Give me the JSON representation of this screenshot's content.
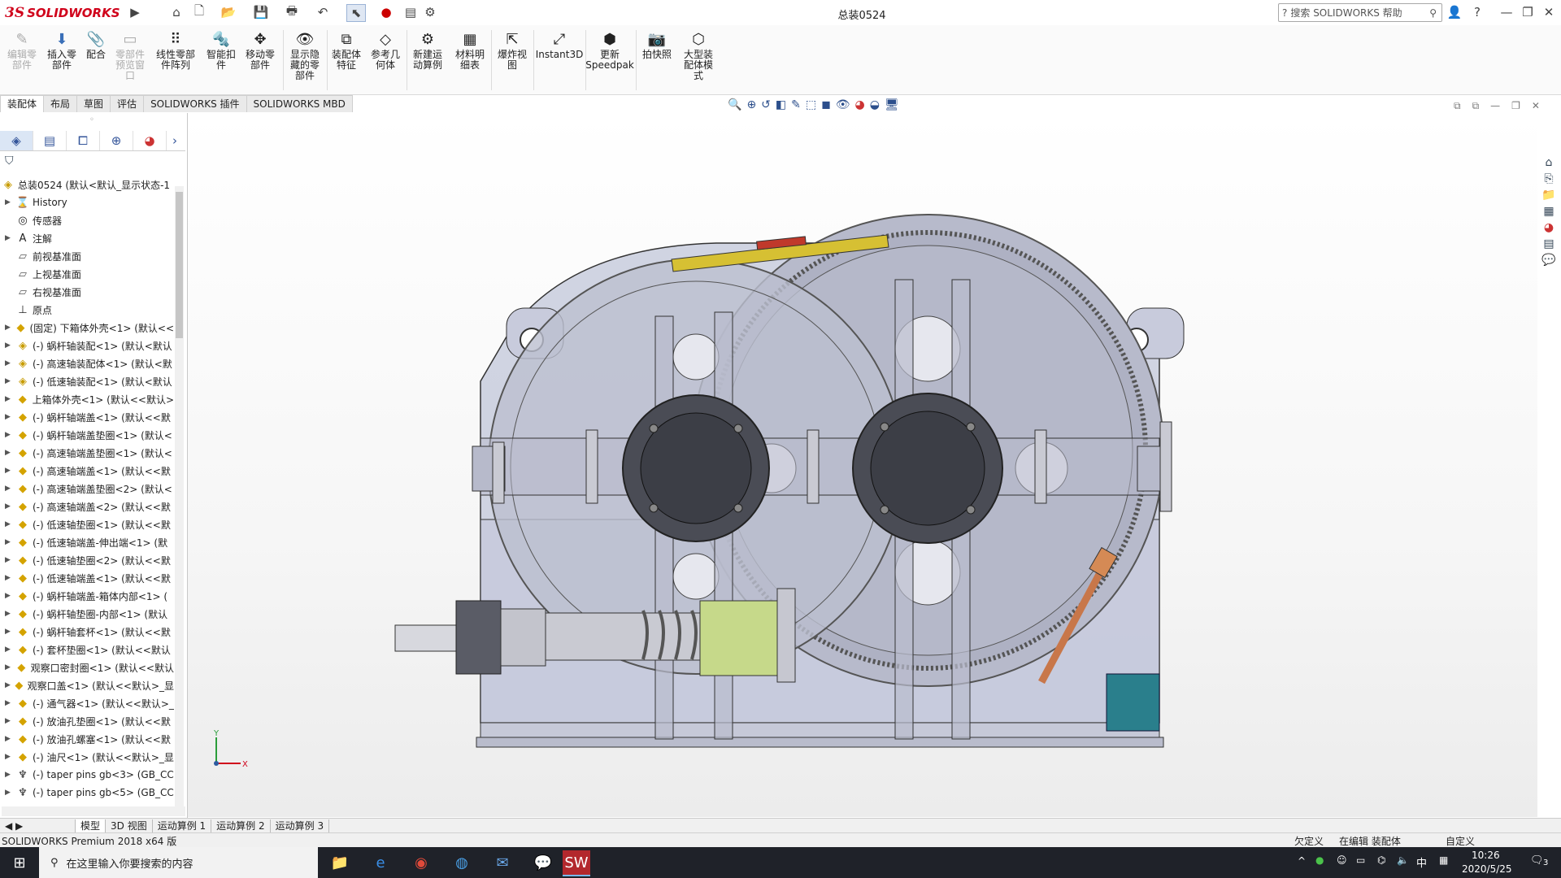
{
  "app": {
    "brand_ds": "3S",
    "brand_name": "SOLIDWORKS",
    "doc_title": "总装0524"
  },
  "titlebar": {
    "help_search_placeholder": "搜索 SOLIDWORKS 帮助",
    "icons": [
      "home-icon",
      "new-icon",
      "open-icon",
      "save-icon",
      "print-icon",
      "undo-icon",
      "select-icon",
      "rebuild-icon",
      "file-props-icon",
      "options-icon"
    ]
  },
  "ribbon": {
    "buttons": [
      {
        "label": "编辑零\n部件",
        "disabled": true
      },
      {
        "label": "插入零\n部件",
        "disabled": false
      },
      {
        "label": "配合",
        "disabled": false
      },
      {
        "label": "零部件\n预览窗\n口",
        "disabled": true
      },
      {
        "label": "线性零部\n件阵列",
        "disabled": false
      },
      {
        "label": "智能扣\n件",
        "disabled": false
      },
      {
        "label": "移动零\n部件",
        "disabled": false
      },
      {
        "label": "显示隐\n藏的零\n部件",
        "disabled": false
      },
      {
        "label": "装配体\n特征",
        "disabled": false
      },
      {
        "label": "参考几\n何体",
        "disabled": false
      },
      {
        "label": "新建运\n动算例",
        "disabled": false
      },
      {
        "label": "材料明\n细表",
        "disabled": false
      },
      {
        "label": "爆炸视\n图",
        "disabled": false
      },
      {
        "label": "Instant3D",
        "disabled": false
      },
      {
        "label": "更新\nSpeedpak",
        "disabled": false
      },
      {
        "label": "拍快照",
        "disabled": false
      },
      {
        "label": "大型装\n配体模\n式",
        "disabled": false
      }
    ]
  },
  "command_tabs": [
    "装配体",
    "布局",
    "草图",
    "评估",
    "SOLIDWORKS 插件",
    "SOLIDWORKS MBD"
  ],
  "tree": {
    "root": "总装0524 (默认<默认_显示状态-1",
    "items": [
      {
        "label": "History",
        "icon": "history-icon",
        "expand": true
      },
      {
        "label": "传感器",
        "icon": "sensor-icon",
        "expand": false
      },
      {
        "label": "注解",
        "icon": "annotation-icon",
        "expand": true
      },
      {
        "label": "前视基准面",
        "icon": "plane-icon",
        "expand": false
      },
      {
        "label": "上视基准面",
        "icon": "plane-icon",
        "expand": false
      },
      {
        "label": "右视基准面",
        "icon": "plane-icon",
        "expand": false
      },
      {
        "label": "原点",
        "icon": "origin-icon",
        "expand": false
      },
      {
        "label": "(固定) 下箱体外壳<1> (默认<<",
        "icon": "part-icon",
        "expand": true
      },
      {
        "label": "(-) 蜗杆轴装配<1> (默认<默认",
        "icon": "assembly-icon",
        "expand": true
      },
      {
        "label": "(-) 高速轴装配体<1> (默认<默",
        "icon": "assembly-icon",
        "expand": true
      },
      {
        "label": "(-) 低速轴装配<1> (默认<默认",
        "icon": "assembly-icon",
        "expand": true
      },
      {
        "label": "上箱体外壳<1> (默认<<默认>",
        "icon": "part-icon",
        "expand": true
      },
      {
        "label": "(-) 蜗杆轴端盖<1> (默认<<默",
        "icon": "part-icon",
        "expand": true
      },
      {
        "label": "(-) 蜗杆轴端盖垫圈<1> (默认<",
        "icon": "part-icon",
        "expand": true
      },
      {
        "label": "(-) 高速轴端盖垫圈<1> (默认<",
        "icon": "part-icon",
        "expand": true
      },
      {
        "label": "(-) 高速轴端盖<1> (默认<<默",
        "icon": "part-icon",
        "expand": true
      },
      {
        "label": "(-) 高速轴端盖垫圈<2> (默认<",
        "icon": "part-icon",
        "expand": true
      },
      {
        "label": "(-) 高速轴端盖<2> (默认<<默",
        "icon": "part-icon",
        "expand": true
      },
      {
        "label": "(-) 低速轴垫圈<1> (默认<<默",
        "icon": "part-icon",
        "expand": true
      },
      {
        "label": "(-) 低速轴端盖-伸出端<1> (默",
        "icon": "part-icon",
        "expand": true
      },
      {
        "label": "(-) 低速轴垫圈<2> (默认<<默",
        "icon": "part-icon",
        "expand": true
      },
      {
        "label": "(-) 低速轴端盖<1> (默认<<默",
        "icon": "part-icon",
        "expand": true
      },
      {
        "label": "(-) 蜗杆轴端盖-箱体内部<1> (",
        "icon": "part-icon",
        "expand": true
      },
      {
        "label": "(-) 蜗杆轴垫圈-内部<1> (默认",
        "icon": "part-icon",
        "expand": true
      },
      {
        "label": "(-) 蜗杆轴套杯<1> (默认<<默",
        "icon": "part-icon",
        "expand": true
      },
      {
        "label": "(-) 套杯垫圈<1> (默认<<默认",
        "icon": "part-icon",
        "expand": true
      },
      {
        "label": "观察口密封圈<1> (默认<<默认",
        "icon": "part-icon",
        "expand": true
      },
      {
        "label": "观察口盖<1> (默认<<默认>_显",
        "icon": "part-icon",
        "expand": true
      },
      {
        "label": "(-) 通气器<1> (默认<<默认>_",
        "icon": "part-icon",
        "expand": true
      },
      {
        "label": "(-) 放油孔垫圈<1> (默认<<默",
        "icon": "part-icon",
        "expand": true
      },
      {
        "label": "(-) 放油孔螺塞<1> (默认<<默",
        "icon": "part-icon",
        "expand": true
      },
      {
        "label": "(-) 油尺<1> (默认<<默认>_显",
        "icon": "part-icon",
        "expand": true
      },
      {
        "label": "(-) taper pins gb<3> (GB_CC",
        "icon": "toolbox-icon",
        "expand": true
      },
      {
        "label": "(-) taper pins gb<5> (GB_CC",
        "icon": "toolbox-icon",
        "expand": true
      }
    ]
  },
  "bottom_tabs": [
    "模型",
    "3D 视图",
    "运动算例 1",
    "运动算例 2",
    "运动算例 3"
  ],
  "status": {
    "left": "SOLIDWORKS Premium 2018 x64 版",
    "underdefined": "欠定义",
    "editing": "在编辑 装配体",
    "units": "自定义"
  },
  "taskbar": {
    "search_placeholder": "在这里输入你要搜索的内容",
    "ime": "中",
    "time": "10:26",
    "date": "2020/5/25",
    "notify_count": "3"
  },
  "triad": {
    "y": "Y",
    "x": "X"
  },
  "colors": {
    "brand": "#d0021b",
    "taskbar": "#1f2229",
    "accent": "#2c5aa0"
  }
}
